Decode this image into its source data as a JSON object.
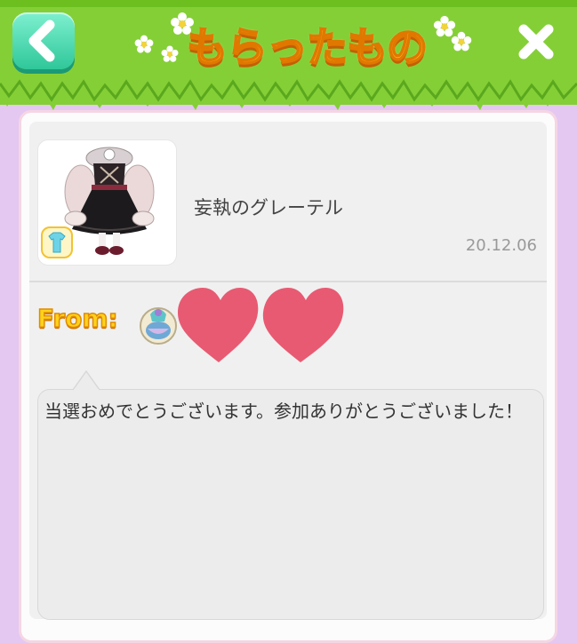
{
  "header": {
    "title": "もらったもの",
    "back_icon": "chevron-left-icon",
    "close_icon": "close-icon"
  },
  "item": {
    "name": "妄執のグレーテル",
    "date": "20.12.06",
    "category_icon": "tops-icon"
  },
  "sender": {
    "from_label": "From:"
  },
  "message": {
    "text": "当選おめでとうございます。参加ありがとうございました！"
  },
  "colors": {
    "header_green": "#85cf36",
    "background_lavender": "#e4c8f2",
    "title_yellow": "#ffc81a",
    "accent_teal": "#2fc79a",
    "heart_pink": "#e85a72"
  }
}
